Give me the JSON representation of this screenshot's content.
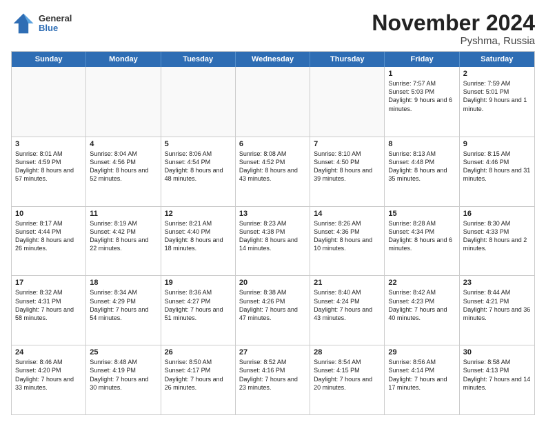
{
  "logo": {
    "general": "General",
    "blue": "Blue"
  },
  "title": "November 2024",
  "location": "Pyshma, Russia",
  "days_of_week": [
    "Sunday",
    "Monday",
    "Tuesday",
    "Wednesday",
    "Thursday",
    "Friday",
    "Saturday"
  ],
  "weeks": [
    [
      {
        "day": "",
        "info": ""
      },
      {
        "day": "",
        "info": ""
      },
      {
        "day": "",
        "info": ""
      },
      {
        "day": "",
        "info": ""
      },
      {
        "day": "",
        "info": ""
      },
      {
        "day": "1",
        "info": "Sunrise: 7:57 AM\nSunset: 5:03 PM\nDaylight: 9 hours and 6 minutes."
      },
      {
        "day": "2",
        "info": "Sunrise: 7:59 AM\nSunset: 5:01 PM\nDaylight: 9 hours and 1 minute."
      }
    ],
    [
      {
        "day": "3",
        "info": "Sunrise: 8:01 AM\nSunset: 4:59 PM\nDaylight: 8 hours and 57 minutes."
      },
      {
        "day": "4",
        "info": "Sunrise: 8:04 AM\nSunset: 4:56 PM\nDaylight: 8 hours and 52 minutes."
      },
      {
        "day": "5",
        "info": "Sunrise: 8:06 AM\nSunset: 4:54 PM\nDaylight: 8 hours and 48 minutes."
      },
      {
        "day": "6",
        "info": "Sunrise: 8:08 AM\nSunset: 4:52 PM\nDaylight: 8 hours and 43 minutes."
      },
      {
        "day": "7",
        "info": "Sunrise: 8:10 AM\nSunset: 4:50 PM\nDaylight: 8 hours and 39 minutes."
      },
      {
        "day": "8",
        "info": "Sunrise: 8:13 AM\nSunset: 4:48 PM\nDaylight: 8 hours and 35 minutes."
      },
      {
        "day": "9",
        "info": "Sunrise: 8:15 AM\nSunset: 4:46 PM\nDaylight: 8 hours and 31 minutes."
      }
    ],
    [
      {
        "day": "10",
        "info": "Sunrise: 8:17 AM\nSunset: 4:44 PM\nDaylight: 8 hours and 26 minutes."
      },
      {
        "day": "11",
        "info": "Sunrise: 8:19 AM\nSunset: 4:42 PM\nDaylight: 8 hours and 22 minutes."
      },
      {
        "day": "12",
        "info": "Sunrise: 8:21 AM\nSunset: 4:40 PM\nDaylight: 8 hours and 18 minutes."
      },
      {
        "day": "13",
        "info": "Sunrise: 8:23 AM\nSunset: 4:38 PM\nDaylight: 8 hours and 14 minutes."
      },
      {
        "day": "14",
        "info": "Sunrise: 8:26 AM\nSunset: 4:36 PM\nDaylight: 8 hours and 10 minutes."
      },
      {
        "day": "15",
        "info": "Sunrise: 8:28 AM\nSunset: 4:34 PM\nDaylight: 8 hours and 6 minutes."
      },
      {
        "day": "16",
        "info": "Sunrise: 8:30 AM\nSunset: 4:33 PM\nDaylight: 8 hours and 2 minutes."
      }
    ],
    [
      {
        "day": "17",
        "info": "Sunrise: 8:32 AM\nSunset: 4:31 PM\nDaylight: 7 hours and 58 minutes."
      },
      {
        "day": "18",
        "info": "Sunrise: 8:34 AM\nSunset: 4:29 PM\nDaylight: 7 hours and 54 minutes."
      },
      {
        "day": "19",
        "info": "Sunrise: 8:36 AM\nSunset: 4:27 PM\nDaylight: 7 hours and 51 minutes."
      },
      {
        "day": "20",
        "info": "Sunrise: 8:38 AM\nSunset: 4:26 PM\nDaylight: 7 hours and 47 minutes."
      },
      {
        "day": "21",
        "info": "Sunrise: 8:40 AM\nSunset: 4:24 PM\nDaylight: 7 hours and 43 minutes."
      },
      {
        "day": "22",
        "info": "Sunrise: 8:42 AM\nSunset: 4:23 PM\nDaylight: 7 hours and 40 minutes."
      },
      {
        "day": "23",
        "info": "Sunrise: 8:44 AM\nSunset: 4:21 PM\nDaylight: 7 hours and 36 minutes."
      }
    ],
    [
      {
        "day": "24",
        "info": "Sunrise: 8:46 AM\nSunset: 4:20 PM\nDaylight: 7 hours and 33 minutes."
      },
      {
        "day": "25",
        "info": "Sunrise: 8:48 AM\nSunset: 4:19 PM\nDaylight: 7 hours and 30 minutes."
      },
      {
        "day": "26",
        "info": "Sunrise: 8:50 AM\nSunset: 4:17 PM\nDaylight: 7 hours and 26 minutes."
      },
      {
        "day": "27",
        "info": "Sunrise: 8:52 AM\nSunset: 4:16 PM\nDaylight: 7 hours and 23 minutes."
      },
      {
        "day": "28",
        "info": "Sunrise: 8:54 AM\nSunset: 4:15 PM\nDaylight: 7 hours and 20 minutes."
      },
      {
        "day": "29",
        "info": "Sunrise: 8:56 AM\nSunset: 4:14 PM\nDaylight: 7 hours and 17 minutes."
      },
      {
        "day": "30",
        "info": "Sunrise: 8:58 AM\nSunset: 4:13 PM\nDaylight: 7 hours and 14 minutes."
      }
    ]
  ]
}
